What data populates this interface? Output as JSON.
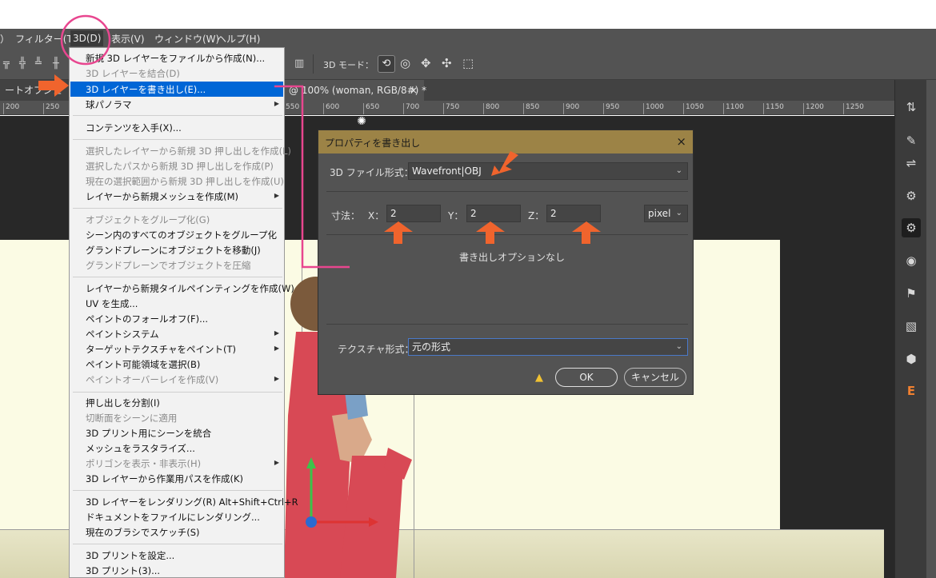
{
  "menubar": {
    "items": [
      "）",
      "フィルター(T)",
      "3D(D)",
      "表示(V)",
      "ウィンドウ(W)",
      "ヘルプ(H)"
    ]
  },
  "options_bar": {
    "mode_label": "3D モード："
  },
  "tab": {
    "left_label": "ートオブジェ",
    "doc_label": "@ 100% (woman, RGB/8#) *",
    "close": "×"
  },
  "ruler": [
    "200",
    "250",
    "300",
    "350",
    "400",
    "450",
    "500",
    "550",
    "600",
    "650",
    "700",
    "750",
    "800",
    "850",
    "900",
    "950",
    "1000",
    "1050",
    "1100",
    "1150",
    "1200",
    "1250"
  ],
  "menu_3d": {
    "items": [
      {
        "label": "新規 3D レイヤーをファイルから作成(N)...",
        "disabled": false
      },
      {
        "label": "3D レイヤーを結合(D)",
        "disabled": true
      },
      {
        "label": "3D レイヤーを書き出し(E)...",
        "disabled": false,
        "highlighted": true
      },
      {
        "label": "球パノラマ",
        "disabled": false,
        "submenu": true
      },
      {
        "label": "コンテンツを入手(X)...",
        "disabled": false
      },
      {
        "label": "選択したレイヤーから新規 3D 押し出しを作成(L)",
        "disabled": true
      },
      {
        "label": "選択したパスから新規 3D 押し出しを作成(P)",
        "disabled": true
      },
      {
        "label": "現在の選択範囲から新規 3D 押し出しを作成(U)",
        "disabled": true
      },
      {
        "label": "レイヤーから新規メッシュを作成(M)",
        "disabled": false,
        "submenu": true
      },
      {
        "label": "オブジェクトをグループ化(G)",
        "disabled": true
      },
      {
        "label": "シーン内のすべてのオブジェクトをグループ化",
        "disabled": false
      },
      {
        "label": "グランドプレーンにオブジェクトを移動(J)",
        "disabled": false
      },
      {
        "label": "グランドプレーンでオブジェクトを圧縮",
        "disabled": true
      },
      {
        "label": "レイヤーから新規タイルペインティングを作成(W)",
        "disabled": false
      },
      {
        "label": "UV を生成...",
        "disabled": false
      },
      {
        "label": "ペイントのフォールオフ(F)...",
        "disabled": false
      },
      {
        "label": "ペイントシステム",
        "disabled": false,
        "submenu": true
      },
      {
        "label": "ターゲットテクスチャをペイント(T)",
        "disabled": false,
        "submenu": true
      },
      {
        "label": "ペイント可能領域を選択(B)",
        "disabled": false
      },
      {
        "label": "ペイントオーバーレイを作成(V)",
        "disabled": true,
        "submenu": true
      },
      {
        "label": "押し出しを分割(I)",
        "disabled": false
      },
      {
        "label": "切断面をシーンに適用",
        "disabled": true
      },
      {
        "label": "3D プリント用にシーンを統合",
        "disabled": false
      },
      {
        "label": "メッシュをラスタライズ...",
        "disabled": false
      },
      {
        "label": "ポリゴンを表示・非表示(H)",
        "disabled": true,
        "submenu": true
      },
      {
        "label": "3D レイヤーから作業用パスを作成(K)",
        "disabled": false
      },
      {
        "label": "3D レイヤーをレンダリング(R)    Alt+Shift+Ctrl+R",
        "disabled": false
      },
      {
        "label": "ドキュメントをファイルにレンダリング...",
        "disabled": false
      },
      {
        "label": "現在のブラシでスケッチ(S)",
        "disabled": false
      },
      {
        "label": "3D プリントを設定...",
        "disabled": false
      },
      {
        "label": "3D プリント(3)...",
        "disabled": false
      }
    ]
  },
  "dialog": {
    "title": "プロパティを書き出し",
    "close": "×",
    "file_format_label": "3D ファイル形式：",
    "file_format_value": "Wavefront|OBJ",
    "size_label": "寸法：",
    "x_label": "X：",
    "x_value": "2",
    "y_label": "Y：",
    "y_value": "2",
    "z_label": "Z：",
    "z_value": "2",
    "unit_value": "pixel",
    "no_options": "書き出しオプションなし",
    "texture_label": "テクスチャ形式：",
    "texture_value": "元の形式",
    "ok": "OK",
    "cancel": "キャンセル",
    "warning_icon": "warning-icon"
  },
  "colors": {
    "highlight": "#0066d6",
    "annotation": "#e8468f",
    "arrow": "#f0642d",
    "dialog_title_bg": "#9c8346"
  }
}
